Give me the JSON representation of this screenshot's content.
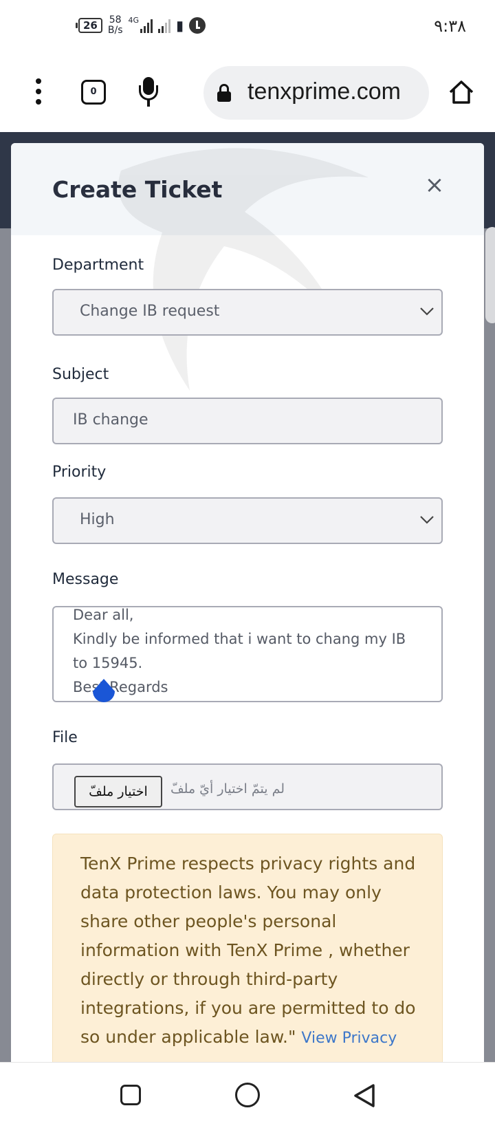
{
  "status_bar": {
    "battery": "26",
    "net_speed_value": "58",
    "net_speed_unit": "B/s",
    "network_type": "4G",
    "time": "٩:٣٨"
  },
  "browser": {
    "url": "tenxprime.com",
    "tab_count": "0"
  },
  "modal": {
    "title": "Create Ticket",
    "close_symbol": "×",
    "department": {
      "label": "Department",
      "value": "Change IB request"
    },
    "subject": {
      "label": "Subject",
      "value": "IB change"
    },
    "priority": {
      "label": "Priority",
      "value": "High"
    },
    "message": {
      "label": "Message",
      "lines": [
        "Dear all,",
        "Kindly be informed that i want to chang my IB",
        "to 15945.",
        "Best Regards"
      ]
    },
    "file": {
      "label": "File",
      "button": "اختيار ملفّ",
      "status": "لم يتمّ اختيار أيّ ملفّ"
    },
    "privacy": {
      "text": "TenX Prime respects privacy rights and data protection laws. You may only share other people's personal information with TenX Prime , whether directly or through third-party integrations, if you are permitted to do so under applicable law.\"",
      "link": "View Privacy"
    }
  },
  "colors": {
    "overlay": "#878a93",
    "header_dark": "#2f3748",
    "privacy_bg": "#fdefd6",
    "privacy_text": "#6d5521",
    "link": "#3d77c9",
    "selection_handle": "#1a56d6"
  },
  "icons": [
    "menu-icon",
    "tab-switcher-icon",
    "mic-icon",
    "lock-icon",
    "home-icon",
    "close-icon",
    "chevron-down-icon",
    "nav-recents-icon",
    "nav-home-icon",
    "nav-back-icon"
  ]
}
